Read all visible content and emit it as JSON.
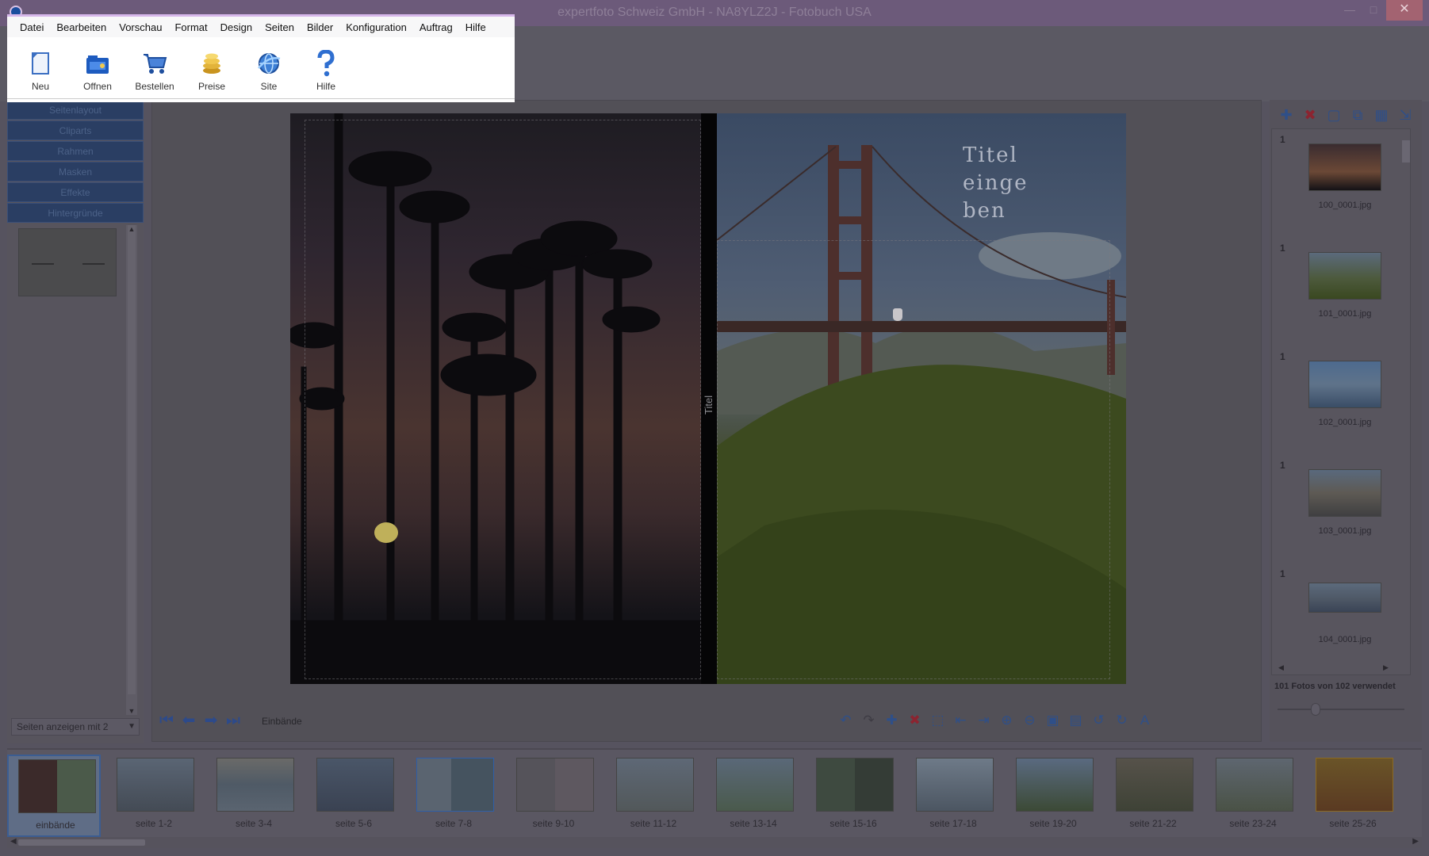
{
  "window": {
    "title": "expertfoto Schweiz GmbH - NA8YLZ2J - Fotobuch USA",
    "minimize": "—",
    "maximize": "□",
    "close": "✕"
  },
  "menu": {
    "items": [
      "Datei",
      "Bearbeiten",
      "Vorschau",
      "Format",
      "Design",
      "Seiten",
      "Bilder",
      "Konfiguration",
      "Auftrag",
      "Hilfe"
    ]
  },
  "ribbon": {
    "buttons": [
      {
        "label": "Neu",
        "icon": "new-document-icon"
      },
      {
        "label": "Offnen",
        "icon": "open-folder-icon"
      },
      {
        "label": "Bestellen",
        "icon": "shopping-cart-icon"
      },
      {
        "label": "Preise",
        "icon": "coins-icon"
      },
      {
        "label": "Site",
        "icon": "globe-icon"
      },
      {
        "label": "Hilfe",
        "icon": "question-icon"
      }
    ]
  },
  "left_panel": {
    "categories": [
      "Seitenlayout",
      "Cliparts",
      "Rahmen",
      "Masken",
      "Effekte",
      "Hintergründe"
    ],
    "page_select": "Seiten anzeigen mit 2"
  },
  "canvas": {
    "spine_text": "Titel",
    "cover_title_lines": [
      "Titel",
      "einge",
      "ben"
    ],
    "nav_label": "Einbände"
  },
  "right_panel": {
    "photos": [
      {
        "count": "1",
        "name": "100_0001.jpg"
      },
      {
        "count": "1",
        "name": "101_0001.jpg"
      },
      {
        "count": "1",
        "name": "102_0001.jpg"
      },
      {
        "count": "1",
        "name": "103_0001.jpg"
      },
      {
        "count": "1",
        "name": "104_0001.jpg"
      }
    ],
    "usage": "101 Fotos von 102 verwendet"
  },
  "film_strip": {
    "pages": [
      "einbände",
      "seite 1-2",
      "seite 3-4",
      "seite 5-6",
      "seite 7-8",
      "seite 9-10",
      "seite 11-12",
      "seite 13-14",
      "seite 15-16",
      "seite 17-18",
      "seite 19-20",
      "seite 21-22",
      "seite 23-24",
      "seite 25-26"
    ],
    "active_index": 0
  },
  "colors": {
    "accent": "#2d4a8a",
    "close_button": "#a36371",
    "menu_border": "#d6b7ea"
  }
}
